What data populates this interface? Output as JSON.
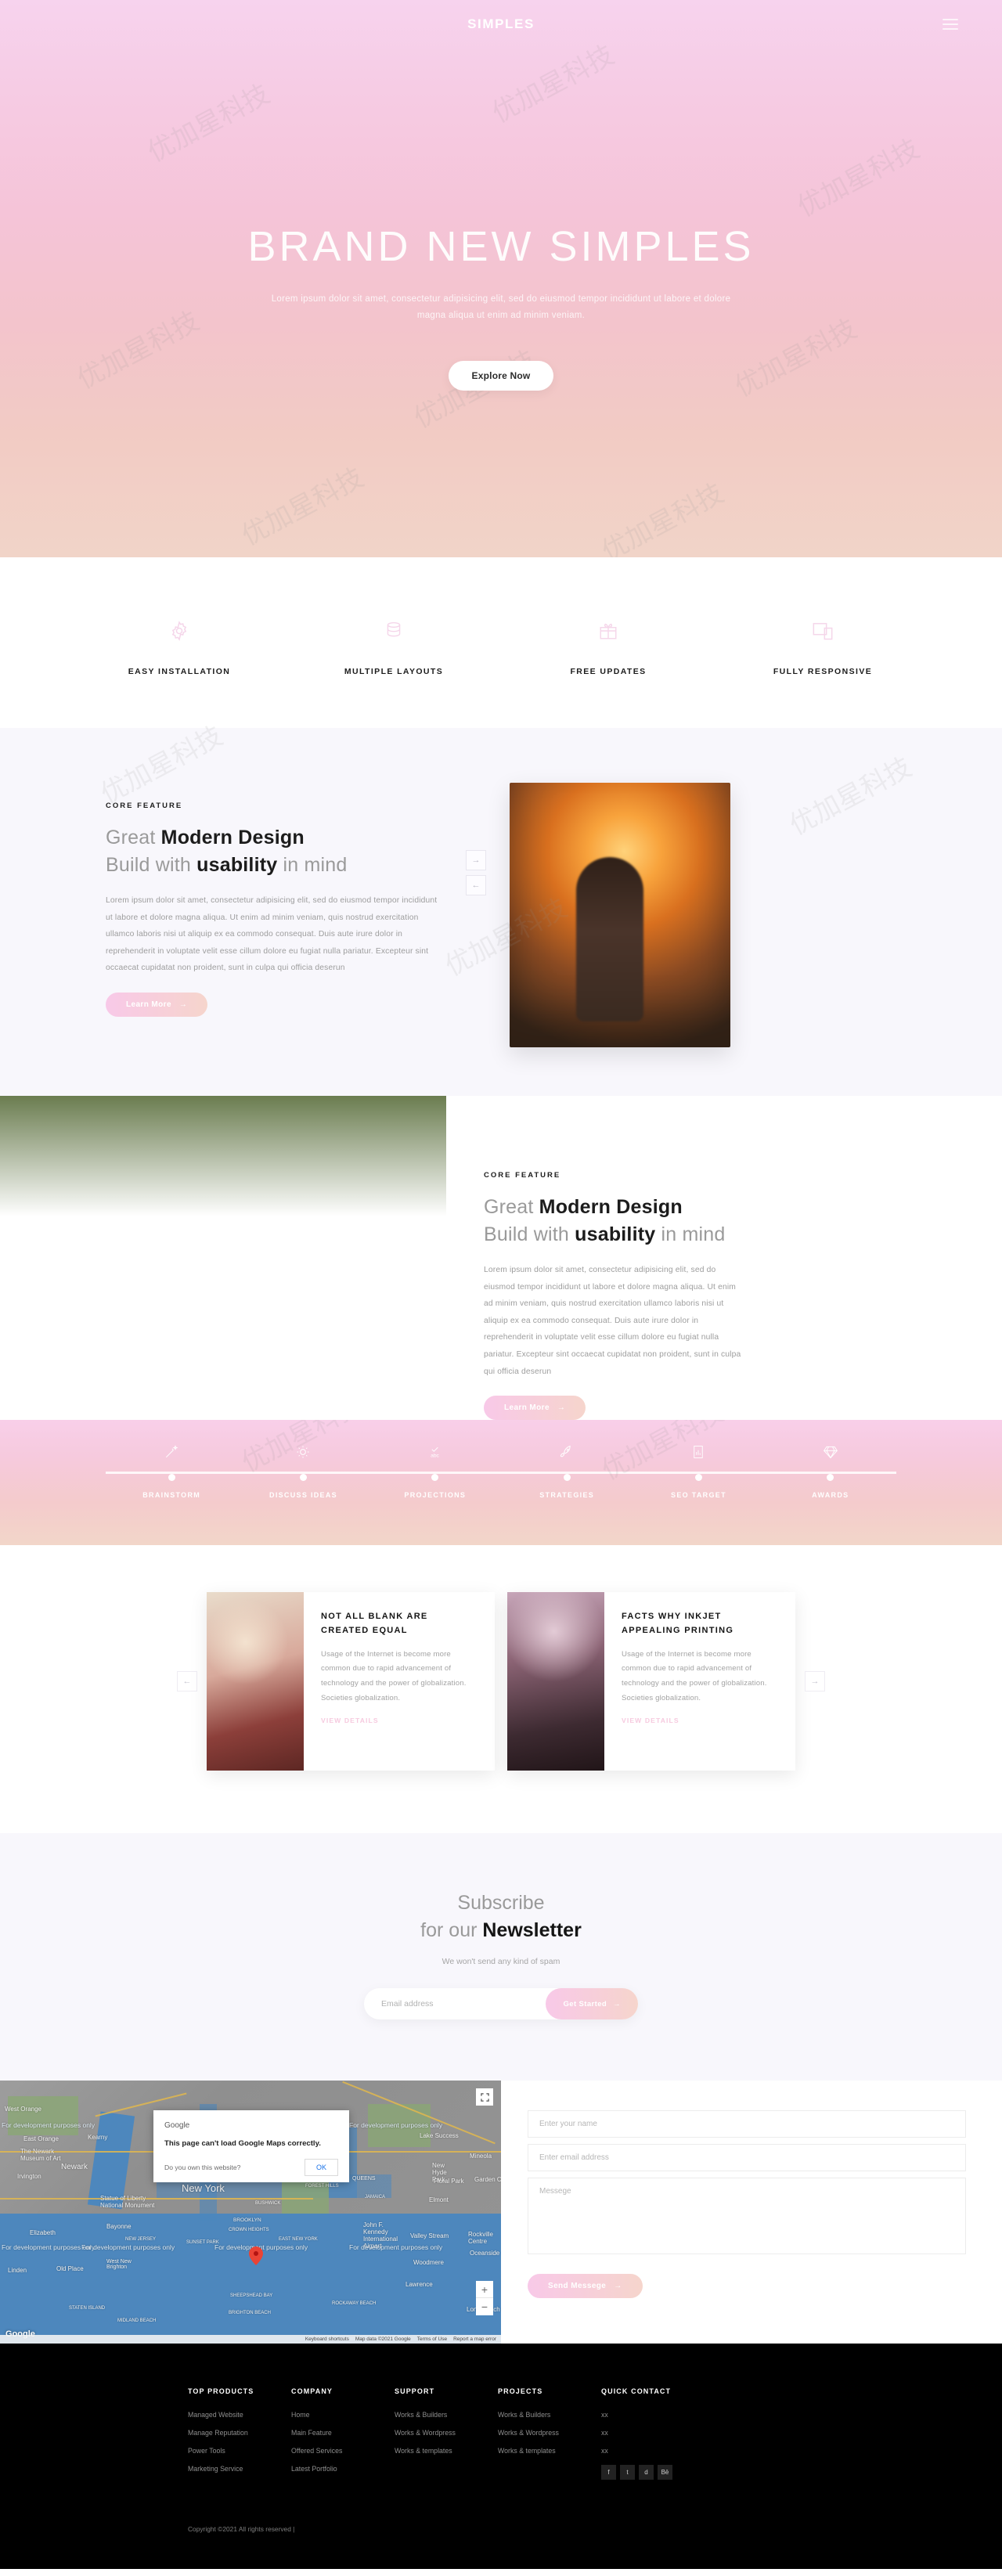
{
  "nav": {
    "brand": "SIMPLES",
    "menu_icon": "hamburger-icon"
  },
  "hero": {
    "title": "BRAND NEW SIMPLES",
    "subtitle": "Lorem ipsum dolor sit amet, consectetur adipisicing elit, sed do eiusmod tempor incididunt ut labore et dolore magna aliqua ut enim ad minim veniam.",
    "button": "Explore Now"
  },
  "features": [
    {
      "label": "EASY INSTALLATION",
      "icon": "gear-icon"
    },
    {
      "label": "MULTIPLE LAYOUTS",
      "icon": "layers-icon"
    },
    {
      "label": "FREE UPDATES",
      "icon": "gift-icon"
    },
    {
      "label": "FULLY RESPONSIVE",
      "icon": "devices-icon"
    }
  ],
  "core1": {
    "eyebrow": "CORE FEATURE",
    "heading_line1_a": "Great ",
    "heading_line1_b": "Modern Design",
    "heading_line2_a": "Build with ",
    "heading_line2_b": "usability",
    "heading_line2_c": " in mind",
    "paragraph": "Lorem ipsum dolor sit amet, consectetur adipisicing elit, sed do eiusmod tempor incididunt ut labore et dolore magna aliqua. Ut enim ad minim veniam, quis nostrud exercitation ullamco laboris nisi ut aliquip ex ea commodo consequat. Duis aute irure dolor in reprehenderit in voluptate velit esse cillum dolore eu fugiat nulla pariatur. Excepteur sint occaecat cupidatat non proident, sunt in culpa qui officia deserun",
    "button": "Learn More",
    "next_arrow": "→",
    "prev_arrow": "←"
  },
  "core2": {
    "eyebrow": "CORE FEATURE",
    "heading_line1_a": "Great ",
    "heading_line1_b": "Modern Design",
    "heading_line2_a": "Build with ",
    "heading_line2_b": "usability",
    "heading_line2_c": " in mind",
    "paragraph": "Lorem ipsum dolor sit amet, consectetur adipisicing elit, sed do eiusmod tempor incididunt ut labore et dolore magna aliqua. Ut enim ad minim veniam, quis nostrud exercitation ullamco laboris nisi ut aliquip ex ea commodo consequat. Duis aute irure dolor in reprehenderit in voluptate velit esse cillum dolore eu fugiat nulla pariatur. Excepteur sint occaecat cupidatat non proident, sunt in culpa qui officia deserun",
    "button": "Learn More"
  },
  "timeline": [
    {
      "label": "BRAINSTORM",
      "icon": "magic-wand-icon"
    },
    {
      "label": "DISCUSS IDEAS",
      "icon": "lightbulb-icon"
    },
    {
      "label": "PROJECTIONS",
      "icon": "abc-check-icon"
    },
    {
      "label": "STRATEGIES",
      "icon": "rocket-icon"
    },
    {
      "label": "SEO TARGET",
      "icon": "chart-document-icon"
    },
    {
      "label": "AWARDS",
      "icon": "diamond-icon"
    }
  ],
  "blog": {
    "prev_arrow": "←",
    "next_arrow": "→",
    "cards": [
      {
        "title": "NOT ALL BLANK ARE CREATED EQUAL",
        "text": "Usage of the Internet is become more common due to rapid advancement of technology and the power of globalization. Societies globalization.",
        "link": "VIEW DETAILS"
      },
      {
        "title": "FACTS WHY INKJET APPEALING PRINTING",
        "text": "Usage of the Internet is become more common due to rapid advancement of technology and the power of globalization. Societies globalization.",
        "link": "VIEW DETAILS"
      }
    ]
  },
  "newsletter": {
    "heading_a": "Subscribe",
    "heading_b_a": "for our ",
    "heading_b_b": "Newsletter",
    "subtitle": "We won't send any kind of spam",
    "placeholder": "Email address",
    "button": "Get Started"
  },
  "map": {
    "logo": "Google",
    "dialog": {
      "brand": "Google",
      "title": "This page can't load Google Maps correctly.",
      "question": "Do you own this website?",
      "ok": "OK"
    },
    "labels": [
      "West Orange",
      "East Orange",
      "Kearny",
      "Newark",
      "The Newark Museum of Art",
      "Irvington",
      "Elizabeth",
      "Bayonne",
      "Linden",
      "Old Place",
      "STATEN ISLAND",
      "New York",
      "Statue of Liberty National Monument",
      "BROOKLYN",
      "CROWN HEIGHTS",
      "BUSHWICK",
      "EAST NEW YORK",
      "QUEENS",
      "JAMAICA",
      "FOREST HILLS",
      "Lake Success",
      "Mineola",
      "New Hyde Park",
      "Floral Park",
      "Garden City",
      "Elmont",
      "John F. Kennedy International Airport",
      "Valley Stream",
      "Rockville Centre",
      "Oceanside",
      "Woodmere",
      "Lawrence",
      "Long Beach",
      "West New Brighton",
      "SHEEPSHEAD BAY",
      "BRIGHTON BEACH",
      "MIDLAND BEACH",
      "NEW JERSEY",
      "SUNSET PARK",
      "ROCKAWAY BEACH"
    ],
    "dev_watermark": "For development purposes only",
    "attribution": [
      "Keyboard shortcuts",
      "Map data ©2021 Google",
      "Terms of Use",
      "Report a map error"
    ],
    "zoom_in": "+",
    "zoom_out": "−"
  },
  "contact_form": {
    "name_placeholder": "Enter your name",
    "email_placeholder": "Enter email address",
    "message_placeholder": "Messege",
    "button": "Send Messege"
  },
  "footer": {
    "columns": [
      {
        "title": "TOP PRODUCTS",
        "links": [
          "Managed Website",
          "Manage Reputation",
          "Power Tools",
          "Marketing Service"
        ]
      },
      {
        "title": "COMPANY",
        "links": [
          "Home",
          "Main Feature",
          "Offered Services",
          "Latest Portfolio"
        ]
      },
      {
        "title": "SUPPORT",
        "links": [
          "Works & Builders",
          "Works & Wordpress",
          "Works & templates"
        ]
      },
      {
        "title": "PROJECTS",
        "links": [
          "Works & Builders",
          "Works & Wordpress",
          "Works & templates"
        ]
      },
      {
        "title": "QUICK CONTACT",
        "links": [
          "xx",
          "xx",
          "xx"
        ]
      }
    ],
    "social": [
      {
        "name": "facebook-icon",
        "glyph": "f"
      },
      {
        "name": "twitter-icon",
        "glyph": "t"
      },
      {
        "name": "dribbble-icon",
        "glyph": "d"
      },
      {
        "name": "behance-icon",
        "glyph": "Bē"
      }
    ],
    "copyright": "Copyright ©2021 All rights reserved |"
  },
  "colors": {
    "accent_pink": "#f8c9e8",
    "accent_peach": "#f6d5cc",
    "dark": "#000000"
  }
}
